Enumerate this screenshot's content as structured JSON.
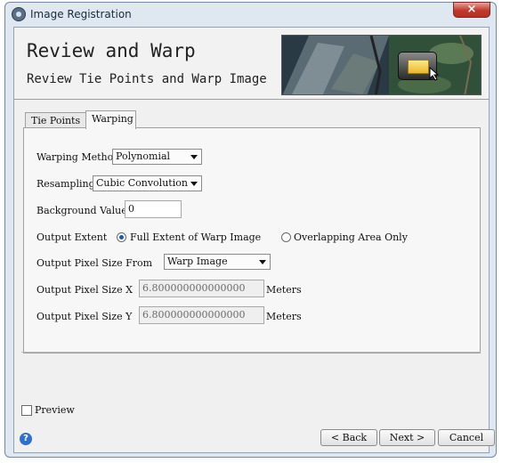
{
  "window": {
    "title": "Image Registration",
    "close_icon": "×"
  },
  "banner": {
    "title": "Review and Warp",
    "subtitle": "Review Tie Points and Warp Image"
  },
  "tabs": [
    {
      "label": "Tie Points"
    },
    {
      "label": "Warping"
    }
  ],
  "form": {
    "warping_method": {
      "label": "Warping Method",
      "value": "Polynomial"
    },
    "resampling": {
      "label": "Resampling",
      "value": "Cubic Convolution"
    },
    "background_value": {
      "label": "Background Value",
      "value": "0"
    },
    "output_extent": {
      "label": "Output Extent",
      "option_full": "Full Extent of Warp Image",
      "option_overlap": "Overlapping Area Only",
      "selected": "full"
    },
    "pixel_size_from": {
      "label": "Output Pixel Size From",
      "value": "Warp Image"
    },
    "pixel_size_x": {
      "label": "Output Pixel Size X",
      "value": "6.800000000000000",
      "unit": "Meters"
    },
    "pixel_size_y": {
      "label": "Output Pixel Size Y",
      "value": "6.800000000000000",
      "unit": "Meters"
    }
  },
  "preview": {
    "label": "Preview",
    "checked": false
  },
  "help_icon": "?",
  "buttons": {
    "back": "< Back",
    "next": "Next >",
    "cancel": "Cancel"
  },
  "icons": [
    "app-icon",
    "close-icon",
    "folder-icon",
    "cursor-icon",
    "chevron-down-icon",
    "help-icon"
  ]
}
